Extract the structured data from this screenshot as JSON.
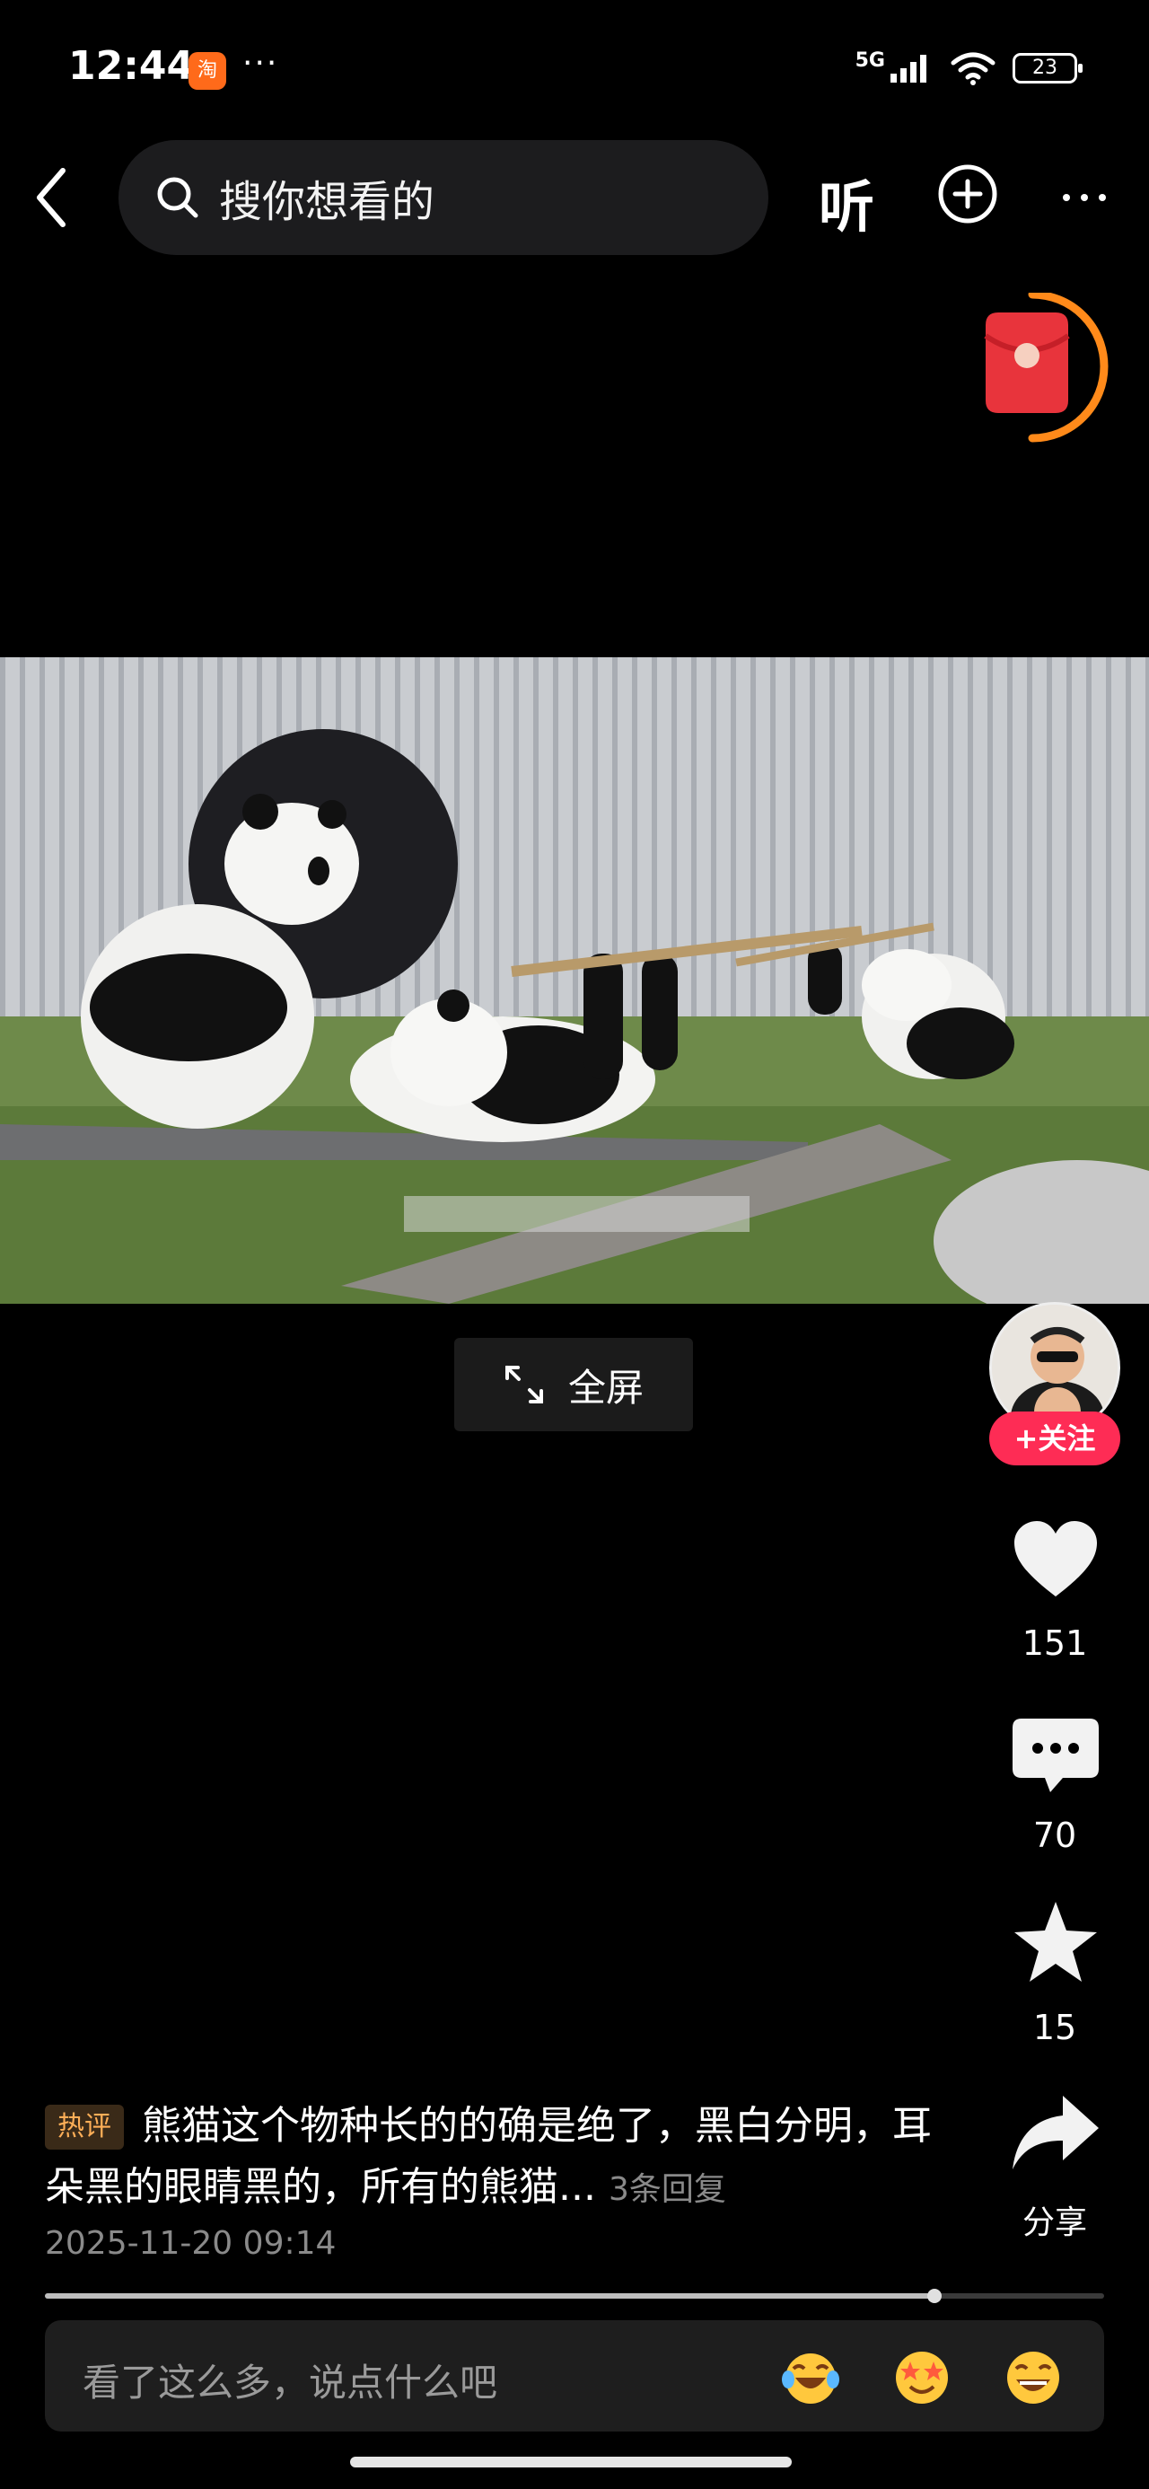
{
  "status": {
    "time": "12:44",
    "app_badge": "淘",
    "dots": "···",
    "network": "5G",
    "battery": "23"
  },
  "nav": {
    "search_placeholder": "搜你想看的",
    "listen_label": "听"
  },
  "video": {
    "fullscreen_label": "全屏",
    "progress_fraction": 0.84
  },
  "rail": {
    "follow_label": "+关注",
    "likes": "151",
    "comments": "70",
    "favorites": "15",
    "share_label": "分享"
  },
  "comment": {
    "tag": "热评",
    "text": "熊猫这个物种长的的确是绝了，黑白分明，耳朵黑的眼睛黑的，所有的熊猫...",
    "replies": "3条回复",
    "date": "2025-11-20 09:14"
  },
  "input": {
    "placeholder": "看了这么多，说点什么吧"
  },
  "colors": {
    "follow": "#fe2c55",
    "hot_tag": "#ffae57",
    "envelope": "#e8343c",
    "envelope_ring": "#ff8a1a"
  }
}
